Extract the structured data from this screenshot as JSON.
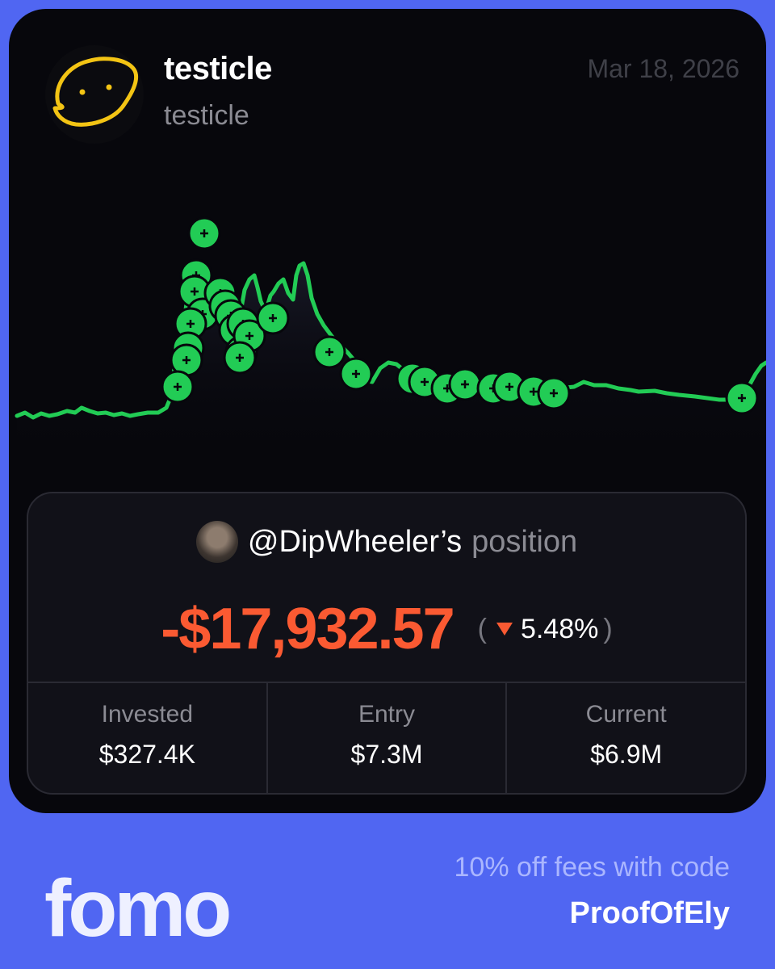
{
  "token": {
    "name": "testicle",
    "ticker": "testicle",
    "date": "Mar 18, 2026"
  },
  "chart": {
    "line_color": "#22cc55",
    "marker_icon": "plus-icon"
  },
  "position": {
    "handle": "@DipWheeler’s",
    "suffix": "position",
    "pnl": "-$17,932.57",
    "change_pct": "5.48%",
    "change_direction": "down",
    "paren_open": "(",
    "paren_close": ")",
    "stats": [
      {
        "label": "Invested",
        "value": "$327.4K"
      },
      {
        "label": "Entry",
        "value": "$7.3M"
      },
      {
        "label": "Current",
        "value": "$6.9M"
      }
    ]
  },
  "footer": {
    "brand": "fomo",
    "promo_line": "10% off fees with code",
    "promo_code": "ProofOfEly"
  },
  "colors": {
    "background": "#5066f2",
    "card": "#07070c",
    "loss": "#fb5a32",
    "accent_green": "#22cc55"
  }
}
